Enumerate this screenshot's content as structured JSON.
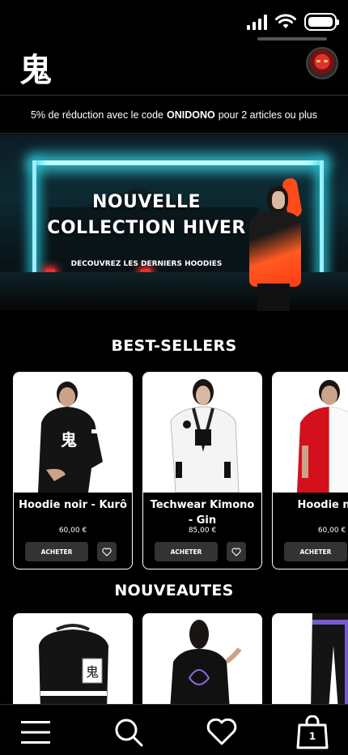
{
  "header": {
    "logo": "鬼",
    "avatar_icon": "oni-mask-avatar"
  },
  "promo": {
    "prefix": "5% de réduction avec le code",
    "code": "ONIDONO",
    "suffix": "pour 2 articles ou plus"
  },
  "hero": {
    "title_line1": "NOUVELLE",
    "title_line2": "COLLECTION HIVER",
    "subtitle": "DECOUVREZ LES DERNIERS HOODIES"
  },
  "best_sellers": {
    "title": "BEST-SELLERS",
    "products": [
      {
        "name": "Hoodie noir - Kurô",
        "price": "60,00 €",
        "button": "ACHETER"
      },
      {
        "name": "Techwear Kimono - Gin",
        "price": "85,00 €",
        "button": "ACHETER"
      },
      {
        "name": "Hoodie noir",
        "price": "60,00 €",
        "button": "ACHETER"
      }
    ]
  },
  "new_arrivals": {
    "title": "NOUVEAUTES"
  },
  "bottom_nav": {
    "items": [
      "menu-icon",
      "search-icon",
      "heart-icon",
      "cart-icon"
    ],
    "cart_count": "1"
  }
}
